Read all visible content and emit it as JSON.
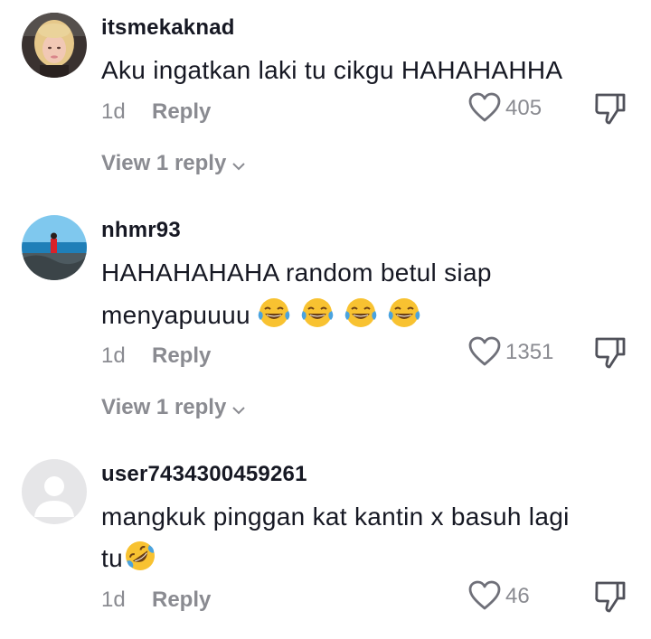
{
  "comments": [
    {
      "username": "itsmekaknad",
      "text": "Aku ingatkan laki tu cikgu HAHAHAHHA",
      "age": "1d",
      "reply_label": "Reply",
      "likes": "405",
      "view_replies": "View 1 reply",
      "avatar": "profile-photo-woman"
    },
    {
      "username": "nhmr93",
      "text_line1": "HAHAHAHAHA random betul siap",
      "text_line2": "menyapuuuu",
      "emojis": [
        "tears-of-joy-emoji",
        "tears-of-joy-emoji",
        "tears-of-joy-emoji",
        "tears-of-joy-emoji"
      ],
      "age": "1d",
      "reply_label": "Reply",
      "likes": "1351",
      "view_replies": "View 1 reply",
      "avatar": "profile-photo-seaside"
    },
    {
      "username": "user7434300459261",
      "text_line1": "mangkuk pinggan kat kantin x basuh lagi",
      "text_line2": "tu",
      "emojis": [
        "rolling-on-floor-laughing-emoji"
      ],
      "age": "1d",
      "reply_label": "Reply",
      "likes": "46",
      "avatar": "default-avatar"
    }
  ],
  "colors": {
    "text_primary": "#161823",
    "text_secondary": "#8a8b91",
    "emoji_yellow": "#f8c231",
    "tear_blue": "#4aa3df"
  },
  "icons": [
    "heart-icon",
    "thumbs-down-icon",
    "chevron-down-icon"
  ]
}
